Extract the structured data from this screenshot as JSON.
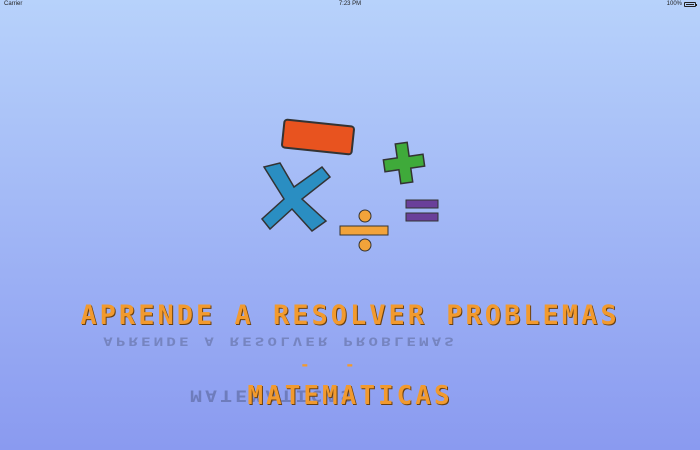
{
  "status_bar": {
    "carrier": "Carrier",
    "time": "7:23 PM",
    "battery": "100%"
  },
  "icons": [
    "minus-sign-icon",
    "plus-sign-icon",
    "multiply-sign-icon",
    "divide-sign-icon",
    "equals-sign-icon"
  ],
  "colors": {
    "title": "#f29a2e",
    "minus": "#e8531f",
    "plus": "#3faa3a",
    "multiply": "#2a8ec2",
    "divide": "#f2a33a",
    "equals": "#6a3f9a"
  },
  "title": "APRENDE A RESOLVER PROBLEMAS",
  "dash": "-",
  "subtitle": "MATEMATICAS"
}
